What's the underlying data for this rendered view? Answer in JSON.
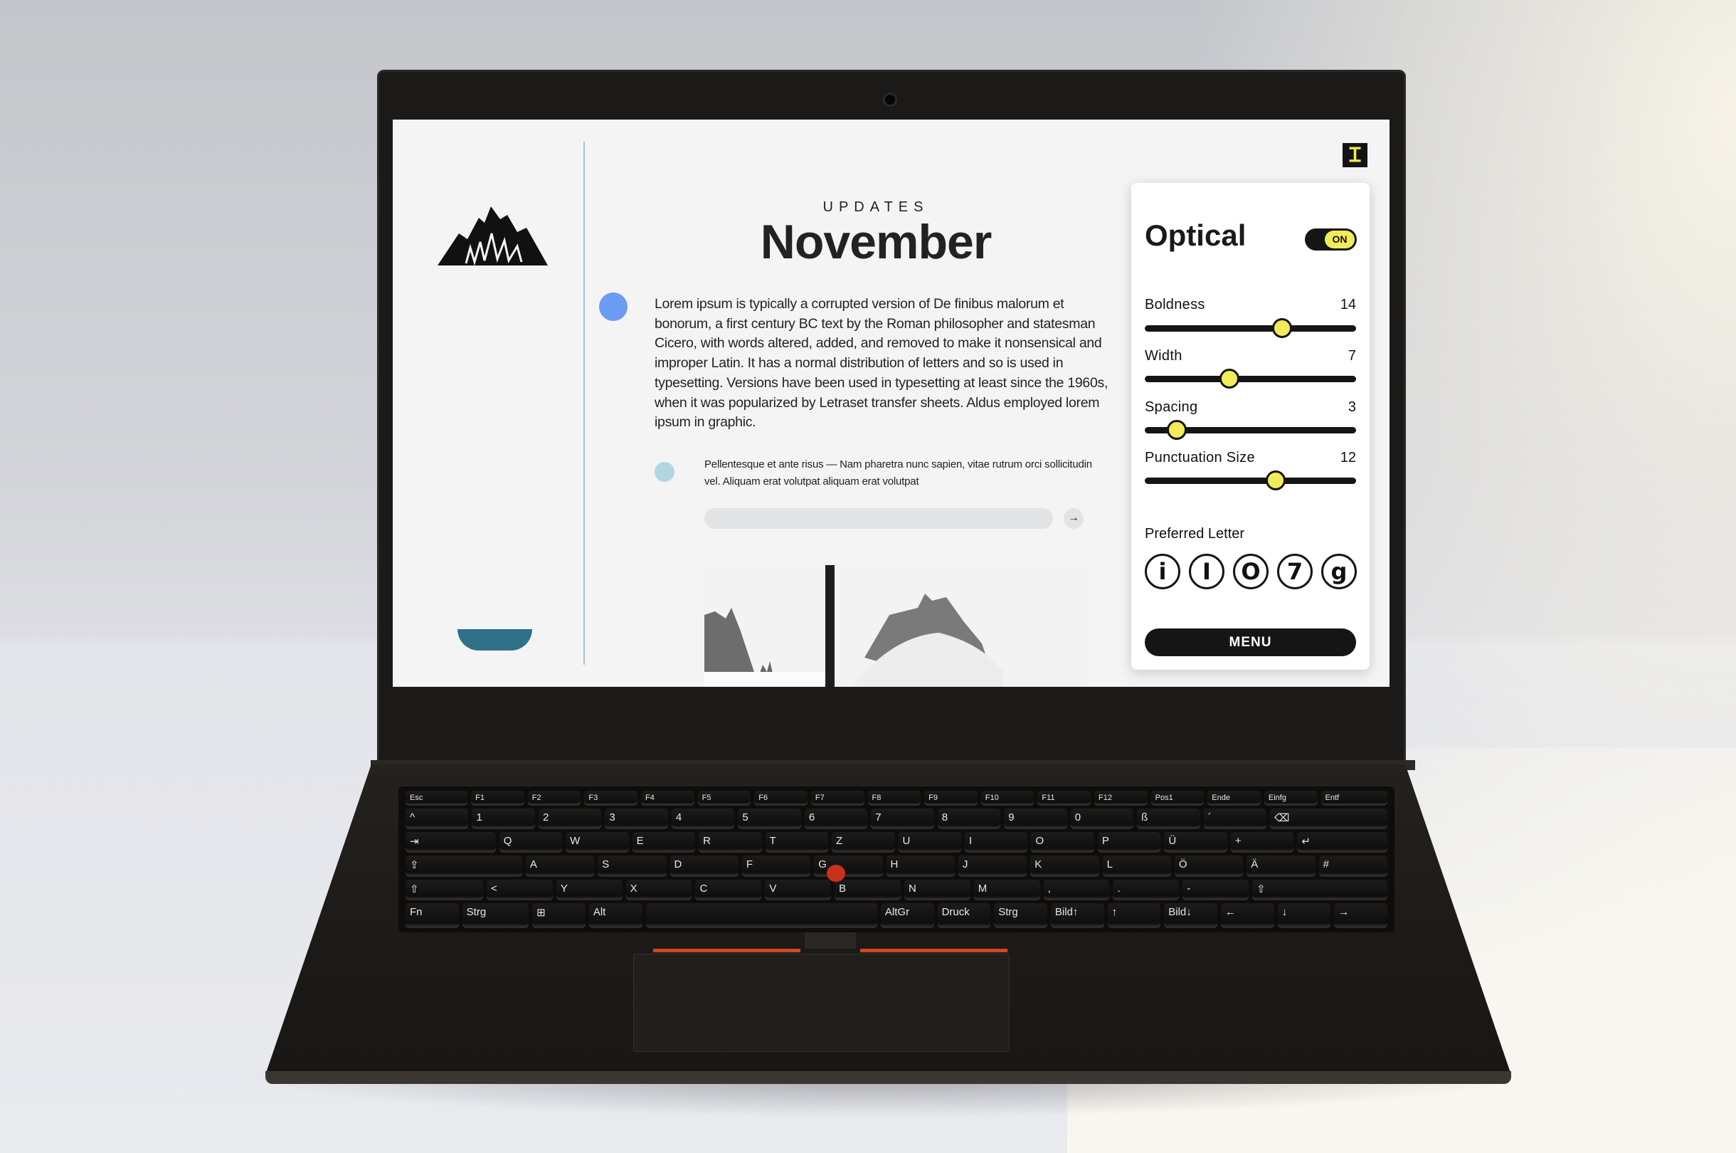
{
  "app": {
    "updates_label": "UPDATES",
    "title": "November",
    "paragraph": "Lorem ipsum is typically a corrupted version of De finibus malorum et bonorum, a first century BC text by the Roman philosopher and statesman Cicero, with words altered, added, and removed to make it nonsensical and improper Latin. It has a normal distribution of letters and so is used in typesetting.  Versions have been used in typesetting at least since the 1960s, when it was popularized by Letraset transfer sheets. Aldus employed lorem ipsum in graphic.",
    "secondary_text": "Pellentesque et ante risus — Nam pharetra nunc sapien, vitae rutrum orci sollicitudin vel. Aliquam erat volutpat aliquam erat volutpat",
    "input_value": "",
    "submit_icon": "arrow-right-icon",
    "submit_glyph": "→",
    "type_tool_glyph": "Ɪ",
    "colors": {
      "accent_blue": "#6a9cf2",
      "light_blue": "#b2d5e4",
      "teal": "#2f7189",
      "yellow": "#f2ec5a"
    }
  },
  "panel": {
    "title": "Optical",
    "toggle_label": "ON",
    "toggle_on": true,
    "sliders": [
      {
        "label": "Boldness",
        "value": "14",
        "position": 0.65
      },
      {
        "label": "Width",
        "value": "7",
        "position": 0.4
      },
      {
        "label": "Spacing",
        "value": "3",
        "position": 0.15
      },
      {
        "label": "Punctuation Size",
        "value": "12",
        "position": 0.62
      }
    ],
    "preferred_label": "Preferred Letter",
    "letters": [
      "i",
      "I",
      "O",
      "7",
      "g"
    ],
    "menu_label": "MENU"
  },
  "keyboard": {
    "rows": [
      [
        "Esc",
        "F1",
        "F2",
        "F3",
        "F4",
        "F5",
        "F6",
        "F7",
        "F8",
        "F9",
        "F10",
        "F11",
        "F12",
        "Pos1",
        "Ende",
        "Einfg",
        "Entf"
      ],
      [
        "^",
        "1",
        "2",
        "3",
        "4",
        "5",
        "6",
        "7",
        "8",
        "9",
        "0",
        "ß",
        "´",
        "⌫"
      ],
      [
        "⇥",
        "Q",
        "W",
        "E",
        "R",
        "T",
        "Z",
        "U",
        "I",
        "O",
        "P",
        "Ü",
        "+",
        "↵"
      ],
      [
        "⇪",
        "A",
        "S",
        "D",
        "F",
        "G",
        "H",
        "J",
        "K",
        "L",
        "Ö",
        "Ä",
        "#"
      ],
      [
        "⇧",
        "<",
        "Y",
        "X",
        "C",
        "V",
        "B",
        "N",
        "M",
        ",",
        ".",
        "-",
        "⇧"
      ],
      [
        "Fn",
        "Strg",
        "⊞",
        "Alt",
        "",
        "AltGr",
        "Druck",
        "Strg",
        "Bild↑",
        "↑",
        "Bild↓",
        "←",
        "↓",
        "→"
      ]
    ]
  }
}
